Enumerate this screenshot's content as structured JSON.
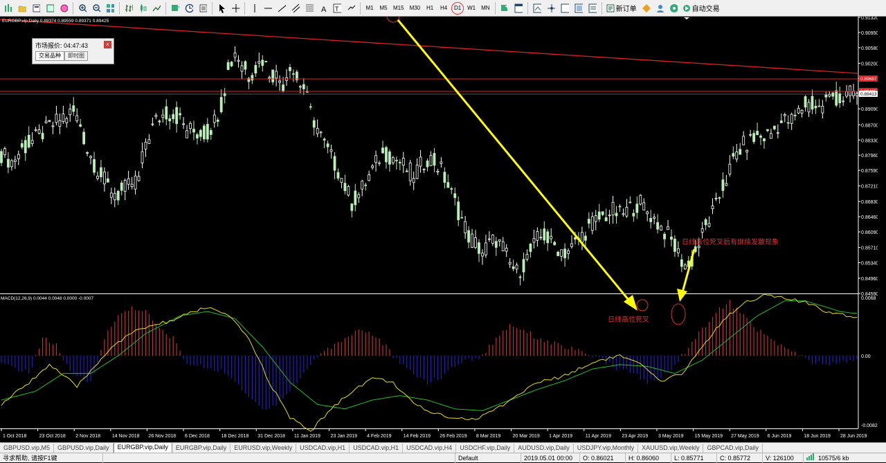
{
  "toolbar": {
    "timeframes": [
      "M1",
      "M5",
      "M15",
      "M30",
      "H1",
      "H4",
      "D1",
      "W1",
      "MN"
    ],
    "active_timeframe": "D1",
    "new_order_label": "新订单",
    "autotrade_label": "自动交易"
  },
  "chart_header": {
    "symbol_line": "EURGBP.vip,Daily  0.89374 0.89559 0.89371 0.89425",
    "macd_line": "MACD(12,26,9) 0.0044 0.0048 0.0000 -0.0007"
  },
  "price_axis": {
    "labels": [
      "0.91320",
      "0.90950",
      "0.90580",
      "0.90200",
      "0.89830",
      "0.89090",
      "0.88700",
      "0.88330",
      "0.87960",
      "0.87590",
      "0.87210",
      "0.86830",
      "0.86460",
      "0.86090",
      "0.85710",
      "0.85340",
      "0.84960",
      "0.84590"
    ],
    "marker_labels": [
      "0.89687",
      "0.89425",
      "0.89413"
    ]
  },
  "macd_axis": {
    "labels": [
      "0.0068",
      "0.00",
      "-0.0082"
    ]
  },
  "date_axis": {
    "labels": [
      "1 Oct 2018",
      "23 Oct 2018",
      "2 Nov 2018",
      "14 Nov 2018",
      "26 Nov 2018",
      "6 Dec 2018",
      "18 Dec 2018",
      "31 Dec 2018",
      "11 Jan 2019",
      "23 Jan 2019",
      "4 Feb 2019",
      "14 Feb 2019",
      "26 Feb 2019",
      "8 Mar 2019",
      "20 Mar 2019",
      "1 Apr 2019",
      "11 Apr 2019",
      "23 Apr 2019",
      "3 May 2019",
      "15 May 2019",
      "27 May 2019",
      "6 Jun 2019",
      "18 Jun 2019",
      "28 Jun 2019"
    ]
  },
  "annotations": {
    "top_note": "日线高位死叉后有继续发散现象",
    "cross_note": "日线高位死叉"
  },
  "popup": {
    "title": "市场报价: 04:47:43",
    "close_label": "×",
    "tabs": [
      "交易品种",
      "即时图"
    ]
  },
  "symbol_tabs": [
    "GBPUSD.vip,M5",
    "GBPUSD.vip,Daily",
    "EURGBP.vip,Daily",
    "EURGBP.vip,Daily",
    "EURUSD.vip,Weekly",
    "USDCAD.vip,H1",
    "USDCAD.vip,H1",
    "USDCAD.vip,H4",
    "USDCHF.vip,Daily",
    "AUDUSD.vip,Daily",
    "USDJPY.vip,Monthly",
    "XAUUSD.vip,Weekly",
    "GBPCAD.vip,Daily"
  ],
  "active_tab_index": 2,
  "status": {
    "help": "寻求帮助, 请按F1键",
    "profile": "Default",
    "time": "2019.05.01 00:00",
    "open": "O: 0.86021",
    "high": "H: 0.86060",
    "low": "L: 0.85771",
    "close": "C: 0.85772",
    "volume": "V: 126100",
    "traffic": "10575/6 kb"
  },
  "colors": {
    "bull": "#b8f0b8",
    "bear": "#ffffff",
    "trendline": "#e02020",
    "arrow": "#ffff00",
    "macd_pos": "#c03030",
    "macd_neg": "#2020c0",
    "signal_green": "#20c020",
    "signal_yellow": "#e8e000",
    "annotation": "#e03030"
  },
  "chart_data": {
    "type": "candlestick",
    "symbol": "EURGBP.vip",
    "timeframe": "Daily",
    "price_ylim": [
      0.8459,
      0.9132
    ],
    "macd_ylim": [
      -0.0082,
      0.0068
    ],
    "price_path": [
      [
        0,
        0.88
      ],
      [
        3,
        0.878
      ],
      [
        6,
        0.881
      ],
      [
        9,
        0.883
      ],
      [
        12,
        0.885
      ],
      [
        15,
        0.887
      ],
      [
        18,
        0.889
      ],
      [
        21,
        0.89
      ],
      [
        23,
        0.887
      ],
      [
        25,
        0.881
      ],
      [
        28,
        0.876
      ],
      [
        31,
        0.872
      ],
      [
        34,
        0.87
      ],
      [
        37,
        0.872
      ],
      [
        40,
        0.874
      ],
      [
        42,
        0.883
      ],
      [
        45,
        0.888
      ],
      [
        48,
        0.89
      ],
      [
        51,
        0.889
      ],
      [
        54,
        0.886
      ],
      [
        57,
        0.885
      ],
      [
        60,
        0.885
      ],
      [
        62,
        0.888
      ],
      [
        64,
        0.892
      ],
      [
        66,
        0.9
      ],
      [
        68,
        0.905
      ],
      [
        70,
        0.902
      ],
      [
        72,
        0.899
      ],
      [
        74,
        0.901
      ],
      [
        76,
        0.903
      ],
      [
        78,
        0.9
      ],
      [
        80,
        0.899
      ],
      [
        82,
        0.897
      ],
      [
        84,
        0.902
      ],
      [
        86,
        0.898
      ],
      [
        88,
        0.896
      ],
      [
        90,
        0.89
      ],
      [
        92,
        0.886
      ],
      [
        94,
        0.882
      ],
      [
        96,
        0.879
      ],
      [
        98,
        0.876
      ],
      [
        100,
        0.872
      ],
      [
        102,
        0.868
      ],
      [
        104,
        0.87
      ],
      [
        106,
        0.873
      ],
      [
        108,
        0.876
      ],
      [
        110,
        0.879
      ],
      [
        112,
        0.88
      ],
      [
        114,
        0.879
      ],
      [
        116,
        0.878
      ],
      [
        118,
        0.876
      ],
      [
        120,
        0.875
      ],
      [
        122,
        0.877
      ],
      [
        124,
        0.879
      ],
      [
        126,
        0.878
      ],
      [
        128,
        0.876
      ],
      [
        130,
        0.872
      ],
      [
        132,
        0.868
      ],
      [
        134,
        0.864
      ],
      [
        136,
        0.86
      ],
      [
        138,
        0.858
      ],
      [
        140,
        0.856
      ],
      [
        142,
        0.858
      ],
      [
        144,
        0.859
      ],
      [
        146,
        0.857
      ],
      [
        148,
        0.853
      ],
      [
        150,
        0.851
      ],
      [
        152,
        0.853
      ],
      [
        154,
        0.856
      ],
      [
        156,
        0.859
      ],
      [
        158,
        0.86
      ],
      [
        160,
        0.858
      ],
      [
        162,
        0.857
      ],
      [
        164,
        0.856
      ],
      [
        166,
        0.857
      ],
      [
        168,
        0.859
      ],
      [
        170,
        0.861
      ],
      [
        172,
        0.863
      ],
      [
        174,
        0.864
      ],
      [
        176,
        0.865
      ],
      [
        178,
        0.866
      ],
      [
        180,
        0.865
      ],
      [
        182,
        0.866
      ],
      [
        184,
        0.867
      ],
      [
        186,
        0.868
      ],
      [
        188,
        0.866
      ],
      [
        190,
        0.864
      ],
      [
        192,
        0.862
      ],
      [
        194,
        0.86
      ],
      [
        196,
        0.857
      ],
      [
        198,
        0.854
      ],
      [
        200,
        0.852
      ],
      [
        202,
        0.856
      ],
      [
        204,
        0.86
      ],
      [
        206,
        0.864
      ],
      [
        208,
        0.867
      ],
      [
        210,
        0.872
      ],
      [
        212,
        0.876
      ],
      [
        214,
        0.88
      ],
      [
        216,
        0.882
      ],
      [
        218,
        0.883
      ],
      [
        220,
        0.884
      ],
      [
        222,
        0.884
      ],
      [
        224,
        0.885
      ],
      [
        226,
        0.887
      ],
      [
        228,
        0.888
      ],
      [
        230,
        0.888
      ],
      [
        232,
        0.89
      ],
      [
        234,
        0.892
      ],
      [
        236,
        0.892
      ],
      [
        238,
        0.891
      ],
      [
        240,
        0.893
      ],
      [
        242,
        0.894
      ],
      [
        244,
        0.893
      ],
      [
        246,
        0.894
      ],
      [
        248,
        0.895
      ],
      [
        249,
        0.8943
      ]
    ],
    "macd_hist_path": [
      [
        0,
        -0.001
      ],
      [
        5,
        -0.0015
      ],
      [
        8,
        -0.002
      ],
      [
        12,
        0.002
      ],
      [
        16,
        0.0012
      ],
      [
        20,
        -0.002
      ],
      [
        26,
        -0.003
      ],
      [
        30,
        0.002
      ],
      [
        34,
        0.0045
      ],
      [
        38,
        0.0055
      ],
      [
        42,
        0.005
      ],
      [
        46,
        0.003
      ],
      [
        50,
        0.002
      ],
      [
        54,
        -0.001
      ],
      [
        58,
        -0.0012
      ],
      [
        62,
        -0.0015
      ],
      [
        66,
        -0.002
      ],
      [
        70,
        -0.004
      ],
      [
        76,
        -0.006
      ],
      [
        80,
        -0.0055
      ],
      [
        84,
        -0.004
      ],
      [
        88,
        -0.002
      ],
      [
        92,
        0.0
      ],
      [
        96,
        0.001
      ],
      [
        100,
        0.002
      ],
      [
        104,
        0.003
      ],
      [
        108,
        0.0025
      ],
      [
        112,
        0.001
      ],
      [
        116,
        -0.001
      ],
      [
        120,
        -0.002
      ],
      [
        124,
        -0.003
      ],
      [
        128,
        -0.0025
      ],
      [
        132,
        -0.001
      ],
      [
        136,
        -0.0005
      ],
      [
        140,
        0.0
      ],
      [
        144,
        0.002
      ],
      [
        148,
        0.0035
      ],
      [
        152,
        0.003
      ],
      [
        156,
        0.002
      ],
      [
        160,
        0.0015
      ],
      [
        164,
        0.001
      ],
      [
        168,
        0.0005
      ],
      [
        172,
        0.0
      ],
      [
        176,
        -0.0008
      ],
      [
        180,
        -0.0015
      ],
      [
        184,
        -0.002
      ],
      [
        188,
        -0.003
      ],
      [
        192,
        -0.0025
      ],
      [
        196,
        -0.001
      ],
      [
        200,
        0.001
      ],
      [
        204,
        0.003
      ],
      [
        208,
        0.005
      ],
      [
        212,
        0.006
      ],
      [
        216,
        0.0045
      ],
      [
        220,
        0.003
      ],
      [
        224,
        0.0018
      ],
      [
        228,
        0.001
      ],
      [
        232,
        0.0
      ],
      [
        236,
        -0.0008
      ],
      [
        240,
        -0.001
      ],
      [
        244,
        -0.0008
      ],
      [
        248,
        -0.0006
      ]
    ],
    "macd_line": [
      [
        0,
        -0.0055
      ],
      [
        8,
        -0.003
      ],
      [
        14,
        -0.001
      ],
      [
        22,
        -0.0035
      ],
      [
        32,
        0.001
      ],
      [
        40,
        0.003
      ],
      [
        50,
        0.004
      ],
      [
        56,
        0.005
      ],
      [
        60,
        0.0055
      ],
      [
        66,
        0.0045
      ],
      [
        72,
        0.002
      ],
      [
        78,
        -0.003
      ],
      [
        84,
        -0.007
      ],
      [
        90,
        -0.0085
      ],
      [
        96,
        -0.006
      ],
      [
        102,
        -0.004
      ],
      [
        108,
        -0.0025
      ],
      [
        114,
        -0.003
      ],
      [
        120,
        -0.0055
      ],
      [
        126,
        -0.0065
      ],
      [
        132,
        -0.007
      ],
      [
        138,
        -0.0072
      ],
      [
        144,
        -0.006
      ],
      [
        150,
        -0.0045
      ],
      [
        156,
        -0.003
      ],
      [
        162,
        -0.0025
      ],
      [
        168,
        -0.0015
      ],
      [
        174,
        -0.0005
      ],
      [
        180,
        0.0
      ],
      [
        186,
        -0.001
      ],
      [
        192,
        -0.003
      ],
      [
        198,
        -0.002
      ],
      [
        204,
        0.001
      ],
      [
        210,
        0.004
      ],
      [
        216,
        0.006
      ],
      [
        222,
        0.0068
      ],
      [
        228,
        0.0065
      ],
      [
        234,
        0.006
      ],
      [
        240,
        0.005
      ],
      [
        244,
        0.0048
      ],
      [
        248,
        0.0044
      ]
    ],
    "signal_line": [
      [
        0,
        -0.005
      ],
      [
        10,
        -0.004
      ],
      [
        18,
        -0.002
      ],
      [
        26,
        -0.002
      ],
      [
        34,
        0.0
      ],
      [
        42,
        0.0025
      ],
      [
        52,
        0.0045
      ],
      [
        60,
        0.005
      ],
      [
        68,
        0.0042
      ],
      [
        76,
        0.001
      ],
      [
        84,
        -0.003
      ],
      [
        92,
        -0.0055
      ],
      [
        100,
        -0.006
      ],
      [
        108,
        -0.005
      ],
      [
        116,
        -0.0045
      ],
      [
        124,
        -0.005
      ],
      [
        132,
        -0.006
      ],
      [
        140,
        -0.0062
      ],
      [
        148,
        -0.005
      ],
      [
        156,
        -0.0038
      ],
      [
        164,
        -0.0028
      ],
      [
        172,
        -0.0015
      ],
      [
        180,
        -0.001
      ],
      [
        188,
        -0.0012
      ],
      [
        196,
        -0.002
      ],
      [
        204,
        -0.0005
      ],
      [
        212,
        0.002
      ],
      [
        220,
        0.0045
      ],
      [
        228,
        0.0062
      ],
      [
        234,
        0.0062
      ],
      [
        240,
        0.0055
      ],
      [
        244,
        0.005
      ],
      [
        248,
        0.0048
      ]
    ]
  }
}
